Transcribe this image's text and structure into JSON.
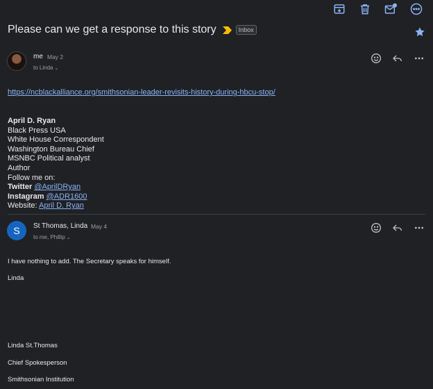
{
  "colors": {
    "background": "#202124",
    "accent": "#8ab4f8",
    "icon": "#8ab4f8",
    "important_marker": "#fbbc04",
    "avatar_blue": "#1565c0"
  },
  "toolbar": {
    "icons": [
      "archive-icon",
      "trash-icon",
      "mark-unread-icon",
      "more-options-icon"
    ]
  },
  "subject": "Please can we get a response to this story",
  "label": "Inbox",
  "messages": [
    {
      "sender": "me",
      "date": "May 2",
      "recipients": "to Linda",
      "link": "https://ncblackalliance.org/smithsonian-leader-revisits-history-during-hbcu-stop/",
      "signature": {
        "name": "April D. Ryan",
        "line1": "Black Press USA",
        "line2": "White House Correspondent",
        "line3": "Washington Bureau Chief",
        "line4": "MSNBC Political analyst",
        "line5": "Author",
        "follow": "Follow me on:",
        "twitter_label": "Twitter",
        "twitter_handle": "@AprilDRyan",
        "instagram_label": "Instagram",
        "instagram_handle": "@ADR1600",
        "website_label": "Website:",
        "website_link": "April D. Ryan"
      }
    },
    {
      "sender": "St Thomas, Linda",
      "avatar_letter": "S",
      "date": "May 4",
      "recipients": "to me, Phillip",
      "body": {
        "line1": "I have nothing to add. The Secretary speaks for himself.",
        "line2": "Linda",
        "sig1": "Linda St.Thomas",
        "sig2": "Chief Spokesperson",
        "sig3": "Smithsonian Institution"
      }
    }
  ]
}
